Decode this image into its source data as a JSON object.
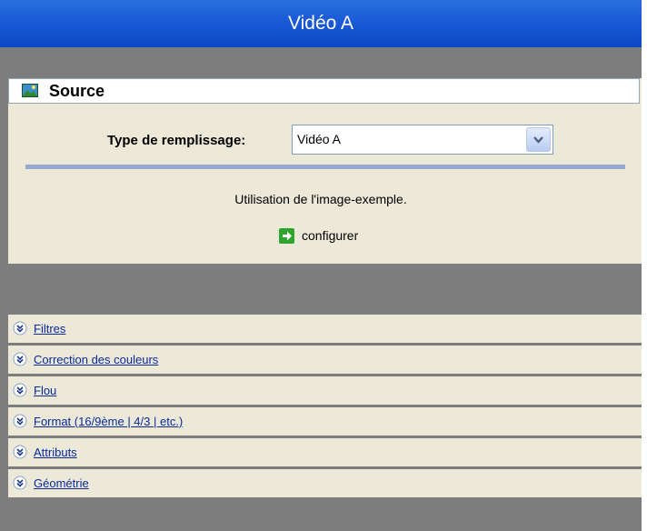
{
  "window": {
    "title": "Vidéo A"
  },
  "source": {
    "title": "Source",
    "icon": "image-icon",
    "fill_label": "Type de remplissage:",
    "fill_value": "Vidéo A",
    "info_text": "Utilisation de l'image-exemple.",
    "configure_label": "configurer"
  },
  "sections": [
    {
      "label": "Filtres"
    },
    {
      "label": "Correction des couleurs"
    },
    {
      "label": "Flou"
    },
    {
      "label": "Format (16/9ème | 4/3 | etc.)"
    },
    {
      "label": "Attributs"
    },
    {
      "label": "Géométrie"
    }
  ],
  "colors": {
    "title_bar": "#1a5ad6",
    "panel_bg": "#ece9d8",
    "gray_bg": "#7d7d7d",
    "link": "#0a2a9e"
  }
}
